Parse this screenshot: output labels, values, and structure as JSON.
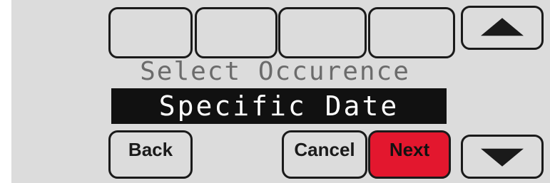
{
  "prompt": "Select Occurence",
  "selected_value": "Specific Date",
  "buttons": {
    "back": "Back",
    "cancel": "Cancel",
    "next": "Next"
  },
  "icons": {
    "up": "up-arrow-icon",
    "down": "down-arrow-icon"
  },
  "colors": {
    "screen_bg": "#dcdcdc",
    "value_bar_bg": "#111111",
    "next_button": "#e3172e"
  }
}
